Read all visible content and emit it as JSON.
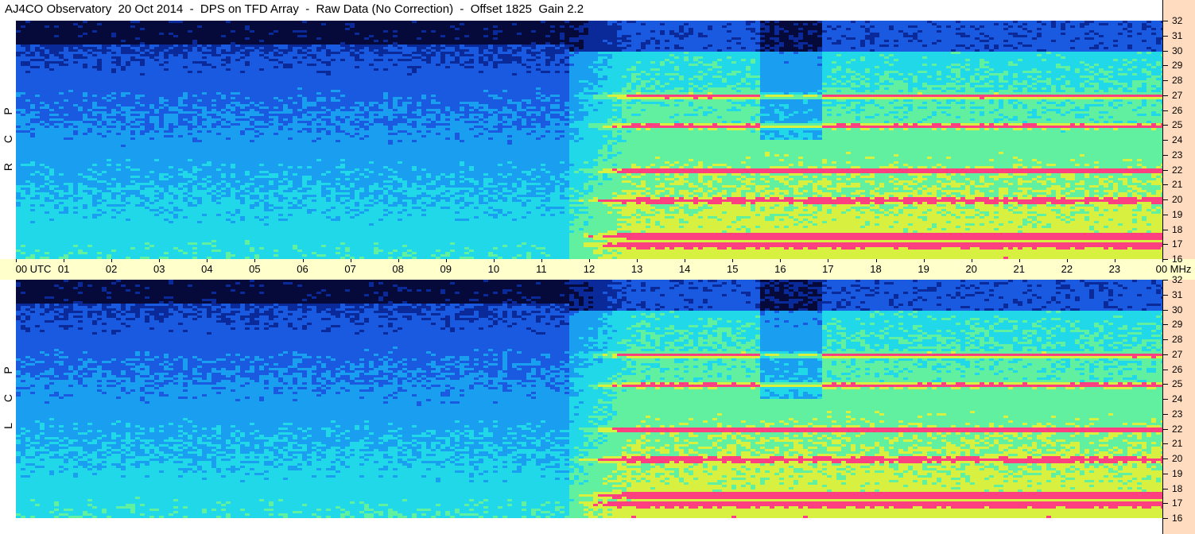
{
  "title": "AJ4CO Observatory  20 Oct 2014  -  DPS on TFD Array  -  Raw Data (No Correction)  -  Offset 1825  Gain 2.2",
  "panels": [
    {
      "id": "top",
      "label": "R C P",
      "letters": [
        "P",
        "C",
        "R"
      ]
    },
    {
      "id": "bottom",
      "label": "L C P",
      "letters": [
        "P",
        "C",
        "L"
      ]
    }
  ],
  "chart_data": {
    "type": "heatmap",
    "title": "AJ4CO Observatory  20 Oct 2014  -  DPS on TFD Array  -  Raw Data (No Correction)  -  Offset 1825  Gain 2.2",
    "xlabel": "UTC",
    "ylabel": "MHz",
    "x_ticks": [
      "00",
      "01",
      "02",
      "03",
      "04",
      "05",
      "06",
      "07",
      "08",
      "09",
      "10",
      "11",
      "12",
      "13",
      "14",
      "15",
      "16",
      "17",
      "18",
      "19",
      "20",
      "21",
      "22",
      "23",
      "00"
    ],
    "x_first_label": "00  UTC",
    "y_unit_label": "MHz",
    "y_ticks": [
      32,
      31,
      30,
      29,
      28,
      27,
      26,
      25,
      24,
      23,
      22,
      21,
      20,
      19,
      18,
      17,
      16
    ],
    "ylim": [
      16,
      32
    ],
    "xlim_hours": [
      0,
      24
    ],
    "series": [
      {
        "name": "R C P",
        "panel": "top"
      },
      {
        "name": "L C P",
        "panel": "bottom"
      }
    ],
    "colormap": [
      "#050a3a",
      "#0a2a9a",
      "#1a5ae0",
      "#1a9ff0",
      "#20d8e8",
      "#60f0a0",
      "#d8f040",
      "#ff4080"
    ],
    "bright_bands_mhz": [
      27.0,
      25.0,
      22.0,
      20.0,
      17.6,
      17.0
    ],
    "day_onset_hour": 11.5
  },
  "colors": {
    "utc_bar": "#ffffcc",
    "freq_axis": "#ffdcc0"
  }
}
